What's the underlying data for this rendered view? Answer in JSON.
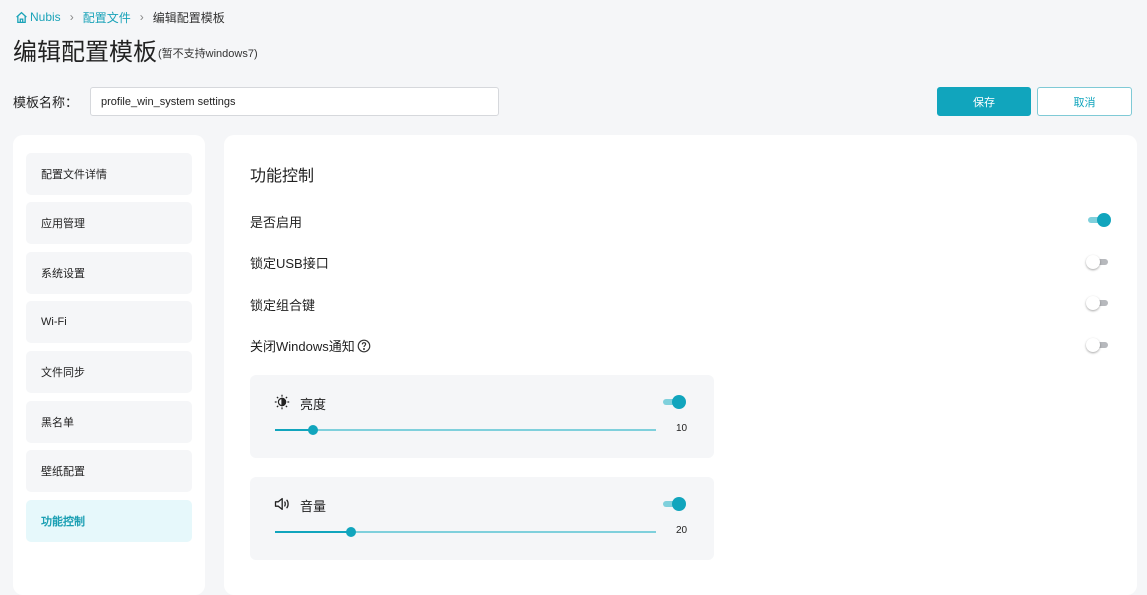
{
  "breadcrumb": {
    "home": "Nubis",
    "profiles": "配置文件",
    "current": "编辑配置模板"
  },
  "title": {
    "main": "编辑配置模板",
    "sub": "(暂不支持windows7)"
  },
  "template_name": {
    "label": "模板名称：",
    "value": "profile_win_system settings"
  },
  "buttons": {
    "save": "保存",
    "cancel": "取消"
  },
  "sidebar": {
    "items": [
      {
        "label": "配置文件详情",
        "active": false
      },
      {
        "label": "应用管理",
        "active": false
      },
      {
        "label": "系统设置",
        "active": false
      },
      {
        "label": "Wi-Fi",
        "active": false
      },
      {
        "label": "文件同步",
        "active": false
      },
      {
        "label": "黑名单",
        "active": false
      },
      {
        "label": "壁纸配置",
        "active": false
      },
      {
        "label": "功能控制",
        "active": true
      }
    ]
  },
  "content": {
    "section_title": "功能控制",
    "rows": [
      {
        "label": "是否启用",
        "enabled": true
      },
      {
        "label": "锁定USB接口",
        "enabled": false
      },
      {
        "label": "锁定组合键",
        "enabled": false
      },
      {
        "label": "关闭Windows通知",
        "enabled": false,
        "help_icon": "question-circle-icon"
      }
    ],
    "brightness": {
      "label": "亮度",
      "icon": "brightness-icon",
      "enabled": true,
      "value": 10,
      "max": 100
    },
    "volume": {
      "label": "音量",
      "icon": "speaker-icon",
      "enabled": true,
      "value": 20,
      "max": 100
    }
  },
  "colors": {
    "accent": "#11a5bd",
    "accent_light": "#7fd0dc",
    "active_bg": "#e6f8fb",
    "page_bg": "#f5f6f8"
  }
}
